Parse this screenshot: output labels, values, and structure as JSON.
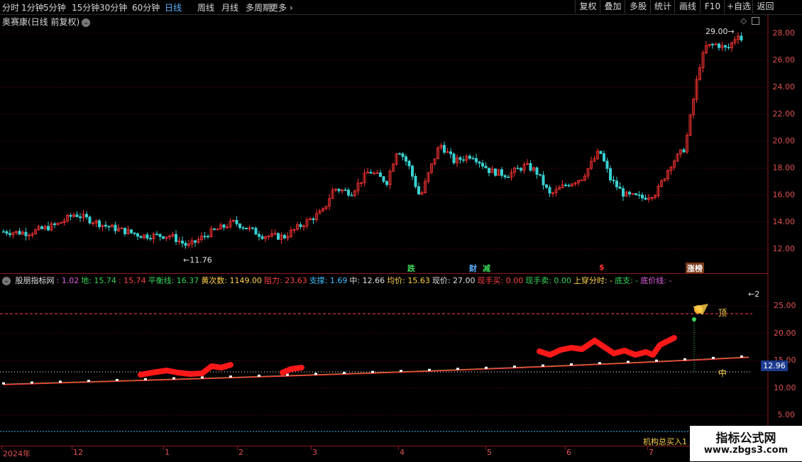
{
  "toolbar": {
    "periods": [
      "分时",
      "1分钟",
      "5分钟",
      "15分钟",
      "30分钟",
      "60分钟",
      "日线",
      "周线",
      "月线",
      "多周期",
      "更多"
    ],
    "active_period": "日线",
    "buttons": [
      "复权",
      "叠加",
      "多股",
      "统计",
      "画线",
      "F10",
      "+自选",
      "返回"
    ]
  },
  "stock": {
    "title": "奥赛康(日线 前复权)",
    "high_label": "29.00",
    "low_label": "11.76"
  },
  "price_axis": [
    "28.00",
    "26.00",
    "24.00",
    "22.00",
    "20.00",
    "18.00",
    "16.00",
    "14.00",
    "12.00"
  ],
  "signals": [
    {
      "text": "跌",
      "color": "#3ad45a"
    },
    {
      "text": "财",
      "color": "#5ab0ff"
    },
    {
      "text": "减",
      "color": "#3ad45a"
    },
    {
      "text": "$",
      "color": "#ff3030"
    },
    {
      "text": "涨榜",
      "color": "#ffffff"
    }
  ],
  "indicator": {
    "name": "股朋指标网",
    "fields": [
      {
        "label": ": 1.02",
        "color": "#e060e0"
      },
      {
        "label": "地: 15.74",
        "color": "#3ad45a"
      },
      {
        "label": ": 15.74",
        "color": "#ff4040"
      },
      {
        "label": "平衡线: 16.37",
        "color": "#3ad45a"
      },
      {
        "label": "黄次数: 1149.00",
        "color": "#ffd24a"
      },
      {
        "label": "阻力: 23.63",
        "color": "#ff4040"
      },
      {
        "label": "支撑: 1.69",
        "color": "#40c0ff"
      },
      {
        "label": "中: 12.66",
        "color": "#e0e0e0"
      },
      {
        "label": "均价: 15.63",
        "color": "#ffd24a"
      },
      {
        "label": "现价: 27.00",
        "color": "#e0e0e0"
      },
      {
        "label": "现手买: 0.00",
        "color": "#ff4040"
      },
      {
        "label": "现手卖: 0.00",
        "color": "#3ad45a"
      },
      {
        "label": "上穿分时: -",
        "color": "#ffd24a"
      },
      {
        "label": "底支: -",
        "color": "#3ad45a"
      },
      {
        "label": "底价线: -",
        "color": "#e060e0"
      }
    ],
    "top_label": "顶",
    "mid_label": "中",
    "current_value": "12.96",
    "arrow_label": "←2",
    "axis": [
      "25.00",
      "20.00",
      "15.00",
      "10.00",
      "5.00"
    ],
    "bottom_text": "机构总买入1"
  },
  "date_axis": [
    "2024年",
    "12",
    "1",
    "2",
    "3",
    "4",
    "5",
    "6",
    "7"
  ],
  "watermark": {
    "line1": "指标公式网",
    "line2": "www.zbgs3.com"
  },
  "colors": {
    "up": "#ff3333",
    "down": "#39d0d0",
    "grid": "#8b1a1a"
  }
}
